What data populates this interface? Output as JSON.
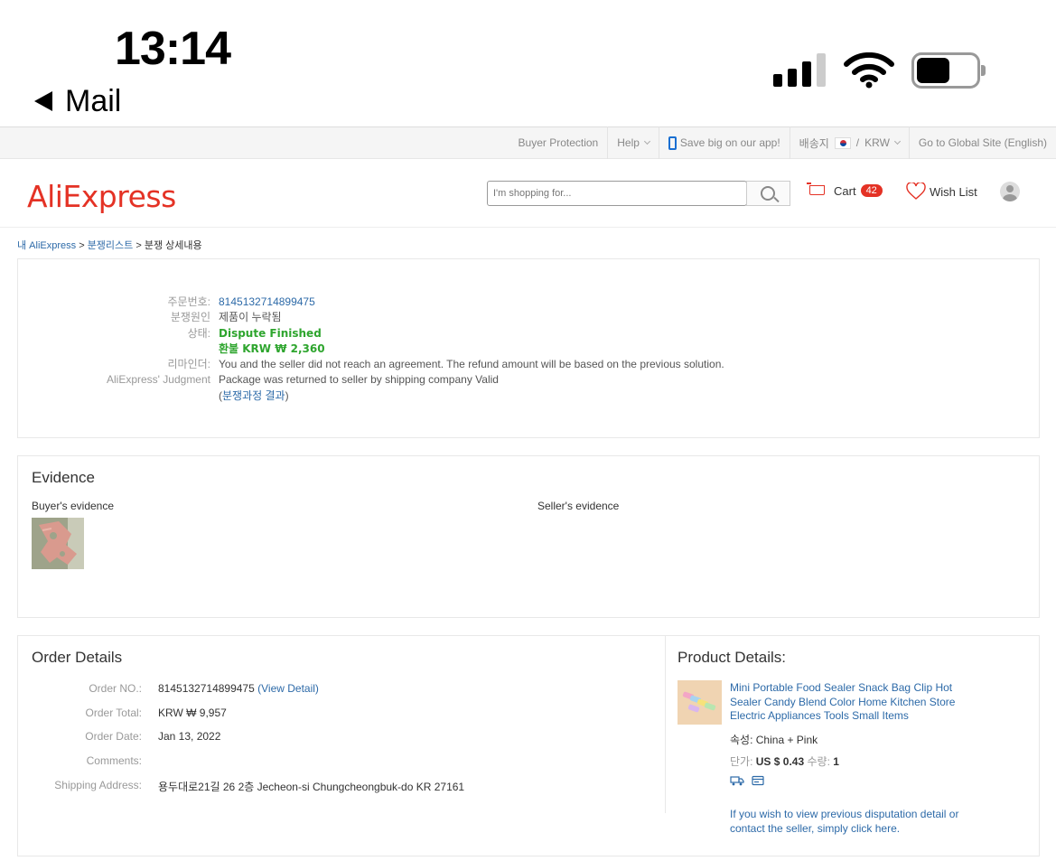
{
  "status_bar": {
    "time": "13:14",
    "back_label": "Mail"
  },
  "topbar": {
    "buyer_protection": "Buyer Protection",
    "help": "Help",
    "app_promo": "Save big on our app!",
    "ship_to_label": "배송지",
    "currency_sep": "/",
    "currency": "KRW",
    "global_site": "Go to Global Site (English)"
  },
  "header": {
    "logo": "AliExpress",
    "search_placeholder": "I'm shopping for...",
    "cart_label": "Cart",
    "cart_count": "42",
    "wishlist_label": "Wish List"
  },
  "breadcrumb": {
    "my_aliexpress": "내 AliExpress",
    "sep1": " > ",
    "dispute_list": "분쟁리스트",
    "sep2": " > ",
    "current": "분쟁 상세내용"
  },
  "dispute": {
    "order_no_label": "주문번호:",
    "order_no": "8145132714899475",
    "reason_label": "분쟁원인",
    "reason": "제품이 누락됨",
    "status_label": "상태:",
    "status": "Dispute Finished",
    "refund": "환불 KRW ₩ 2,360",
    "reminder_label": "리마인더:",
    "reminder": "You and the seller did not reach an agreement. The refund amount will be based on the previous solution.",
    "judgment_label": "AliExpress' Judgment",
    "judgment": "Package was returned to seller by shipping company Valid",
    "result_open": "(",
    "result_link": "분쟁과정 결과",
    "result_close": ")"
  },
  "evidence": {
    "title": "Evidence",
    "buyer_label": "Buyer's evidence",
    "seller_label": "Seller's evidence"
  },
  "order_details": {
    "title": "Order Details",
    "order_no_label": "Order NO.:",
    "order_no": "8145132714899475",
    "view_detail": "(View Detail)",
    "total_label": "Order Total:",
    "total": "KRW ₩ 9,957",
    "date_label": "Order Date:",
    "date": "Jan 13, 2022",
    "comments_label": "Comments:",
    "comments": "",
    "address_label": "Shipping Address:",
    "address": "용두대로21길 26 2층 Jecheon-si Chungcheongbuk-do KR 27161"
  },
  "product_details": {
    "title": "Product Details:",
    "name": "Mini Portable Food Sealer Snack Bag Clip Hot Sealer Candy Blend Color Home Kitchen Store Electric Appliances Tools Small Items",
    "attr_label": "속성:",
    "attr_value": "China + Pink",
    "unit_price_label": "단가:",
    "unit_price": "US $ 0.43",
    "qty_label": "수량:",
    "qty": "1",
    "contact_note": "If you wish to view previous disputation detail or contact the seller, simply click here."
  },
  "colors": {
    "brand": "#e43225",
    "link": "#2d6aa8",
    "status_green": "#2ea52e"
  }
}
